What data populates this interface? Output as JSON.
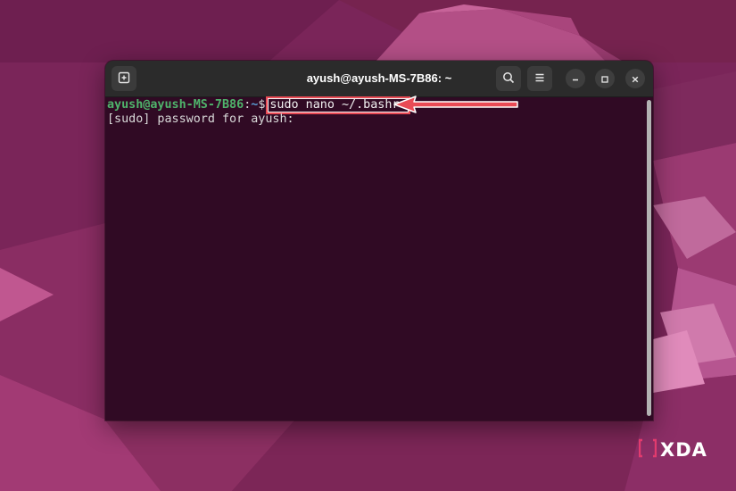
{
  "window": {
    "title": "ayush@ayush-MS-7B86: ~"
  },
  "titlebar": {
    "icons": {
      "new_tab": "new-tab-icon",
      "search": "search-icon",
      "menu": "hamburger-menu-icon",
      "minimize": "minimize-icon",
      "maximize": "maximize-icon",
      "close": "close-icon"
    }
  },
  "terminal": {
    "prompt_user": "ayush@ayush-MS-7B86",
    "prompt_colon": ":",
    "prompt_path": "~",
    "prompt_symbol": "$",
    "command": "sudo nano ~/.bashrc",
    "output_line": "[sudo] password for ayush:"
  },
  "watermark": {
    "brand": "XDA"
  },
  "colors": {
    "terminal_bg": "#300a24",
    "titlebar_bg": "#2b2b2b",
    "prompt_user": "#4fb36b",
    "prompt_path": "#5aa0d8",
    "highlight": "#e94b55",
    "desktop_base": "#7a2559"
  }
}
